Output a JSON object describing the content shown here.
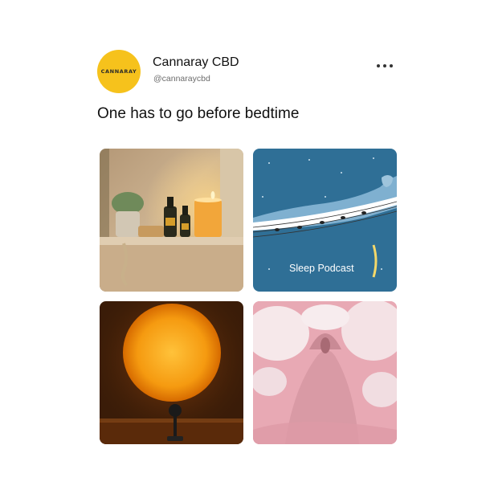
{
  "post": {
    "avatar_text": "CANNARAY",
    "name": "Cannaray CBD",
    "handle": "@cannaraycbd",
    "caption": "One has to go before bedtime",
    "more_icon": "more-horizontal-icon"
  },
  "tiles": [
    {
      "name": "bathroom-shelf-candle-image"
    },
    {
      "name": "sleep-podcast-image",
      "label": "Sleep Podcast"
    },
    {
      "name": "sunset-lamp-image"
    },
    {
      "name": "pink-bubble-bath-image"
    }
  ],
  "colors": {
    "brand_yellow": "#f6c21c",
    "text_primary": "#111111",
    "text_secondary": "#6b6b6b"
  }
}
